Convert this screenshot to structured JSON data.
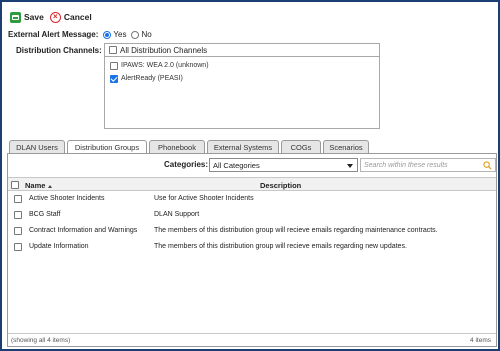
{
  "toolbar": {
    "save_label": "Save",
    "cancel_label": "Cancel"
  },
  "alert": {
    "label": "External Alert Message:",
    "options": [
      {
        "label": "Yes",
        "selected": true
      },
      {
        "label": "No",
        "selected": false
      }
    ]
  },
  "distribution": {
    "label": "Distribution Channels:",
    "all_label": "All Distribution Channels",
    "all_checked": false,
    "channels": [
      {
        "label": "IPAWS: WEA 2.0 (unknown)",
        "checked": false
      },
      {
        "label": "AlertReady (PEASI)",
        "checked": true
      }
    ]
  },
  "tabs": [
    {
      "label": "DLAN Users",
      "active": false
    },
    {
      "label": "Distribution Groups",
      "active": true
    },
    {
      "label": "Phonebook",
      "active": false
    },
    {
      "label": "External Systems",
      "active": false
    },
    {
      "label": "COGs",
      "active": false
    },
    {
      "label": "Scenarios",
      "active": false
    }
  ],
  "filter": {
    "categories_label": "Categories:",
    "categories_value": "All Categories",
    "search_placeholder": "Search within these results"
  },
  "table": {
    "columns": {
      "name": "Name",
      "description": "Description"
    },
    "sort": "name-ascending",
    "rows": [
      {
        "name": "Active Shooter Incidents",
        "description": "Use for Active Shooter Incidents"
      },
      {
        "name": "BCG Staff",
        "description": "DLAN Support"
      },
      {
        "name": "Contract Information and Warnings",
        "description": "The members of this distribution group will recieve emails regarding maintenance contracts."
      },
      {
        "name": "Update Information",
        "description": "The members of this distribution group will recieve emails regarding new updates."
      }
    ]
  },
  "footer": {
    "showing": "(showing all 4 items)",
    "count": "4 items"
  },
  "colors": {
    "frame": "#1c3f73",
    "save": "#2e9b3e",
    "cancel": "#d9262c",
    "accent": "#1a73e8"
  }
}
